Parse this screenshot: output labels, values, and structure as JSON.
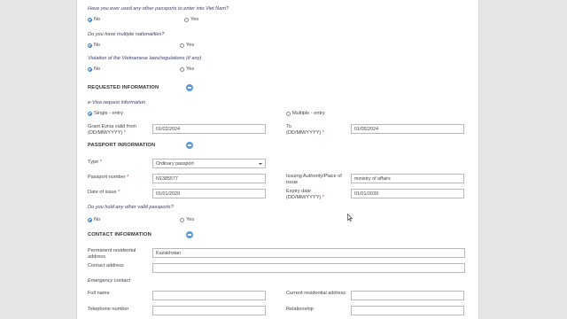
{
  "questions": {
    "other_passports": {
      "label": "Have you ever used any other passports to enter into Viet Nam?",
      "options": [
        "No",
        "Yes"
      ],
      "selected": "No"
    },
    "multiple_nationalities": {
      "label": "Do you have multiple nationalities?",
      "options": [
        "No",
        "Yes"
      ],
      "selected": "No"
    },
    "violation": {
      "label": "Violation of the Vietnamese laws/regulations (if any)",
      "options": [
        "No",
        "Yes"
      ],
      "selected": "No"
    },
    "other_valid_passports": {
      "label": "Do you hold any other valid passports?",
      "options": [
        "No",
        "Yes"
      ],
      "selected": "No"
    }
  },
  "requested": {
    "title": "REQUESTED INFORMATION",
    "evisa_label": "e-Visa request information",
    "entry_single": "Single - entry",
    "entry_multiple": "Multiple - entry",
    "selected_entry": "Single - entry",
    "valid_from_label": "Grant Evisa valid from",
    "valid_from_format": "(DD/MM/YYYY)",
    "valid_from_value": "01/02/2024",
    "to_label": "To",
    "to_format": "(DD/MM/YYYY)",
    "to_value": "01/05/2024"
  },
  "passport": {
    "title": "PASSPORT INRORMATION",
    "type_label": "Type",
    "type_value": "Ordinary passport",
    "number_label": "Passport number",
    "number_value": "N1385577",
    "authority_label": "Issuing Authority/Place of issue",
    "authority_value": "ministry of affairs",
    "issue_label": "Date of issue",
    "issue_value": "01/01/2020",
    "expiry_label": "Expiry date",
    "expiry_format": "(DD/MM/YYYY)",
    "expiry_value": "01/01/2030"
  },
  "contact": {
    "title": "CONTACT INFORMATION",
    "permanent_label": "Permanent residential address",
    "permanent_value": "Kazakhstan",
    "contact_label": "Contact address",
    "contact_value": "",
    "emergency_label": "Emergency contact",
    "fullname_label": "Full name",
    "fullname_value": "",
    "current_label": "Current residential address",
    "current_value": "",
    "phone_label": "Telephone number",
    "phone_value": "",
    "relationship_label": "Relationship",
    "relationship_value": ""
  },
  "colors": {
    "accent": "#5b9bd5",
    "required": "#c0392b",
    "question": "#3a3a6a"
  }
}
